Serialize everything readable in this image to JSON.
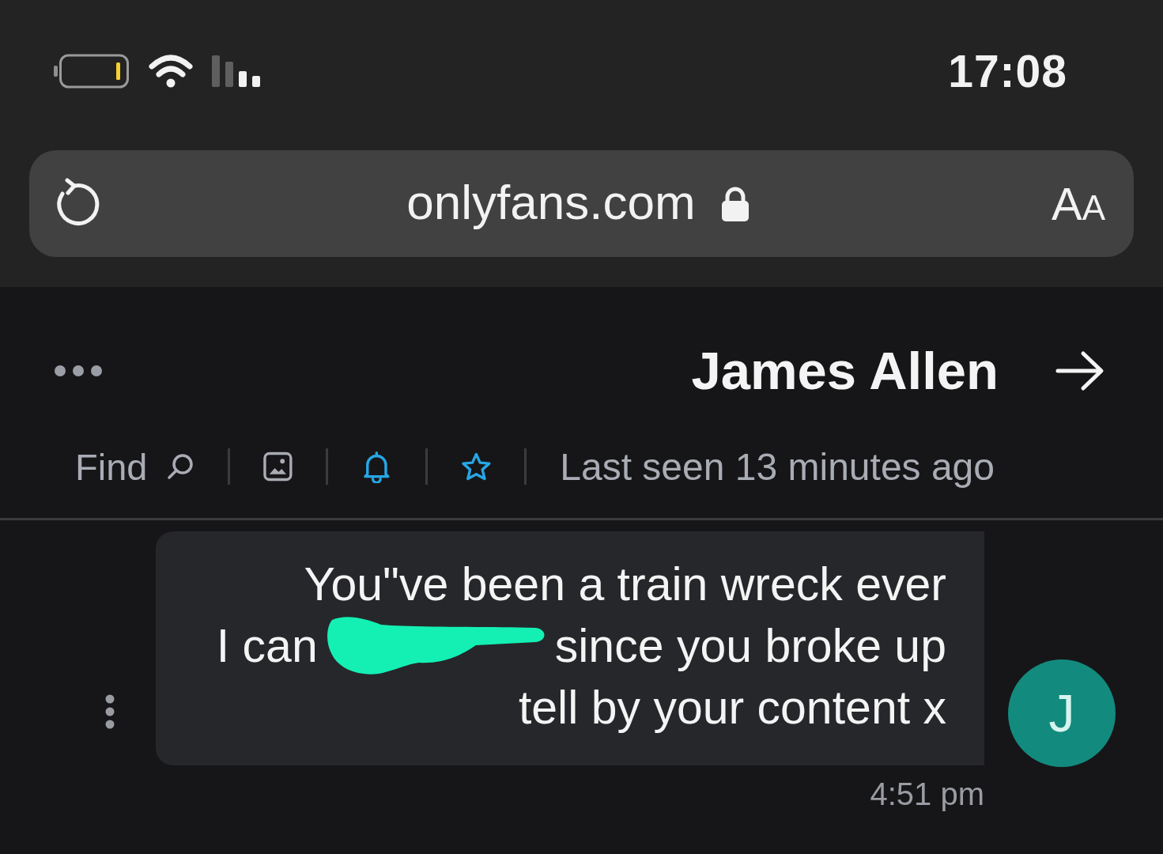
{
  "status_bar": {
    "time": "17:08"
  },
  "address_bar": {
    "url": "onlyfans.com",
    "secure": true,
    "reader_button": "AA"
  },
  "chat_header": {
    "name": "James Allen",
    "last_seen": "Last seen 13 minutes ago",
    "toolbar": [
      {
        "kind": "star",
        "active": true
      },
      {
        "kind": "bell",
        "active": true
      },
      {
        "kind": "gallery",
        "active": false
      },
      {
        "kind": "search",
        "label": "Find"
      }
    ]
  },
  "messages": [
    {
      "lines": [
        [
          {
            "kind": "text",
            "text": "You\"ve been a train wreck ever"
          }
        ],
        [
          {
            "kind": "text",
            "text": "I can"
          },
          {
            "kind": "redaction"
          },
          {
            "kind": "text",
            "text": "since you broke up"
          }
        ],
        [
          {
            "kind": "text",
            "text": "tell by your content x"
          }
        ]
      ],
      "time": "4:51 pm",
      "avatar": "J"
    }
  ]
}
